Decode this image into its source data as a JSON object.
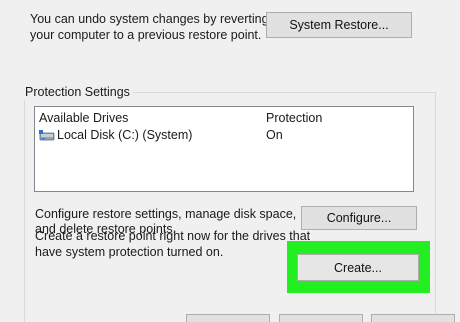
{
  "intro": {
    "line1": "You can undo system changes by reverting",
    "line2": "your computer to a previous restore point."
  },
  "system_restore_button": "System Restore...",
  "protection": {
    "legend": "Protection Settings",
    "columns": [
      "Available Drives",
      "Protection"
    ],
    "drives": [
      {
        "name": "Local Disk (C:) (System)",
        "protection": "On",
        "icon": "hard-drive-icon"
      }
    ]
  },
  "configure": {
    "line1": "Configure restore settings, manage disk space,",
    "line2": "and delete restore points.",
    "button": "Configure..."
  },
  "create": {
    "line1": "Create a restore point right now for the drives that",
    "line2": "have system protection turned on.",
    "button": "Create..."
  },
  "colors": {
    "highlight": "#22ee22",
    "background": "#f0f0f0",
    "button_face": "#e1e1e1"
  }
}
